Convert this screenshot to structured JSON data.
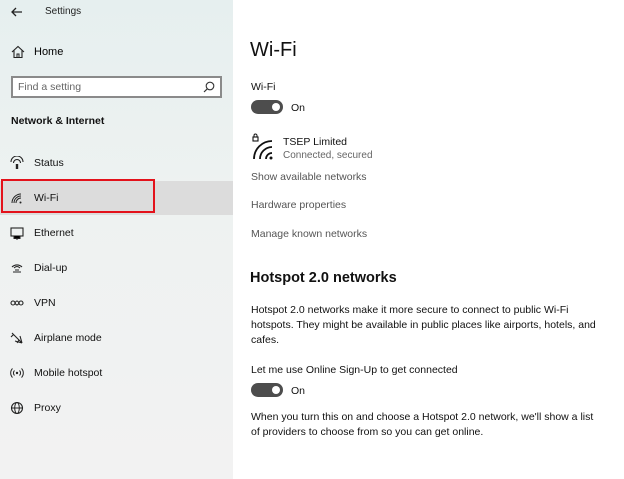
{
  "window": {
    "title": "Settings"
  },
  "sidebar": {
    "home_label": "Home",
    "search_placeholder": "Find a setting",
    "section_heading": "Network & Internet",
    "items": [
      {
        "label": "Status",
        "icon": "status-icon"
      },
      {
        "label": "Wi-Fi",
        "icon": "wifi-icon",
        "selected": true
      },
      {
        "label": "Ethernet",
        "icon": "ethernet-icon"
      },
      {
        "label": "Dial-up",
        "icon": "dialup-icon"
      },
      {
        "label": "VPN",
        "icon": "vpn-icon"
      },
      {
        "label": "Airplane mode",
        "icon": "airplane-icon"
      },
      {
        "label": "Mobile hotspot",
        "icon": "hotspot-icon"
      },
      {
        "label": "Proxy",
        "icon": "globe-icon"
      }
    ]
  },
  "main": {
    "title": "Wi-Fi",
    "wifi_label": "Wi-Fi",
    "wifi_toggle_state": "On",
    "network": {
      "name": "TSEP Limited",
      "status": "Connected, secured"
    },
    "links": [
      "Show available networks",
      "Hardware properties",
      "Manage known networks"
    ],
    "hotspot": {
      "heading": "Hotspot 2.0 networks",
      "description": "Hotspot 2.0 networks make it more secure to connect to public Wi-Fi hotspots. They might be available in public places like airports, hotels, and cafes.",
      "signup_label": "Let me use Online Sign-Up to get connected",
      "signup_toggle_state": "On",
      "footer": "When you turn this on and choose a Hotspot 2.0 network, we'll show a list of providers to choose from so you can get online."
    }
  },
  "colors": {
    "selection_outline": "#e3121b",
    "toggle_on": "#4d4d4d",
    "selected_bg": "#dcdcdc"
  }
}
